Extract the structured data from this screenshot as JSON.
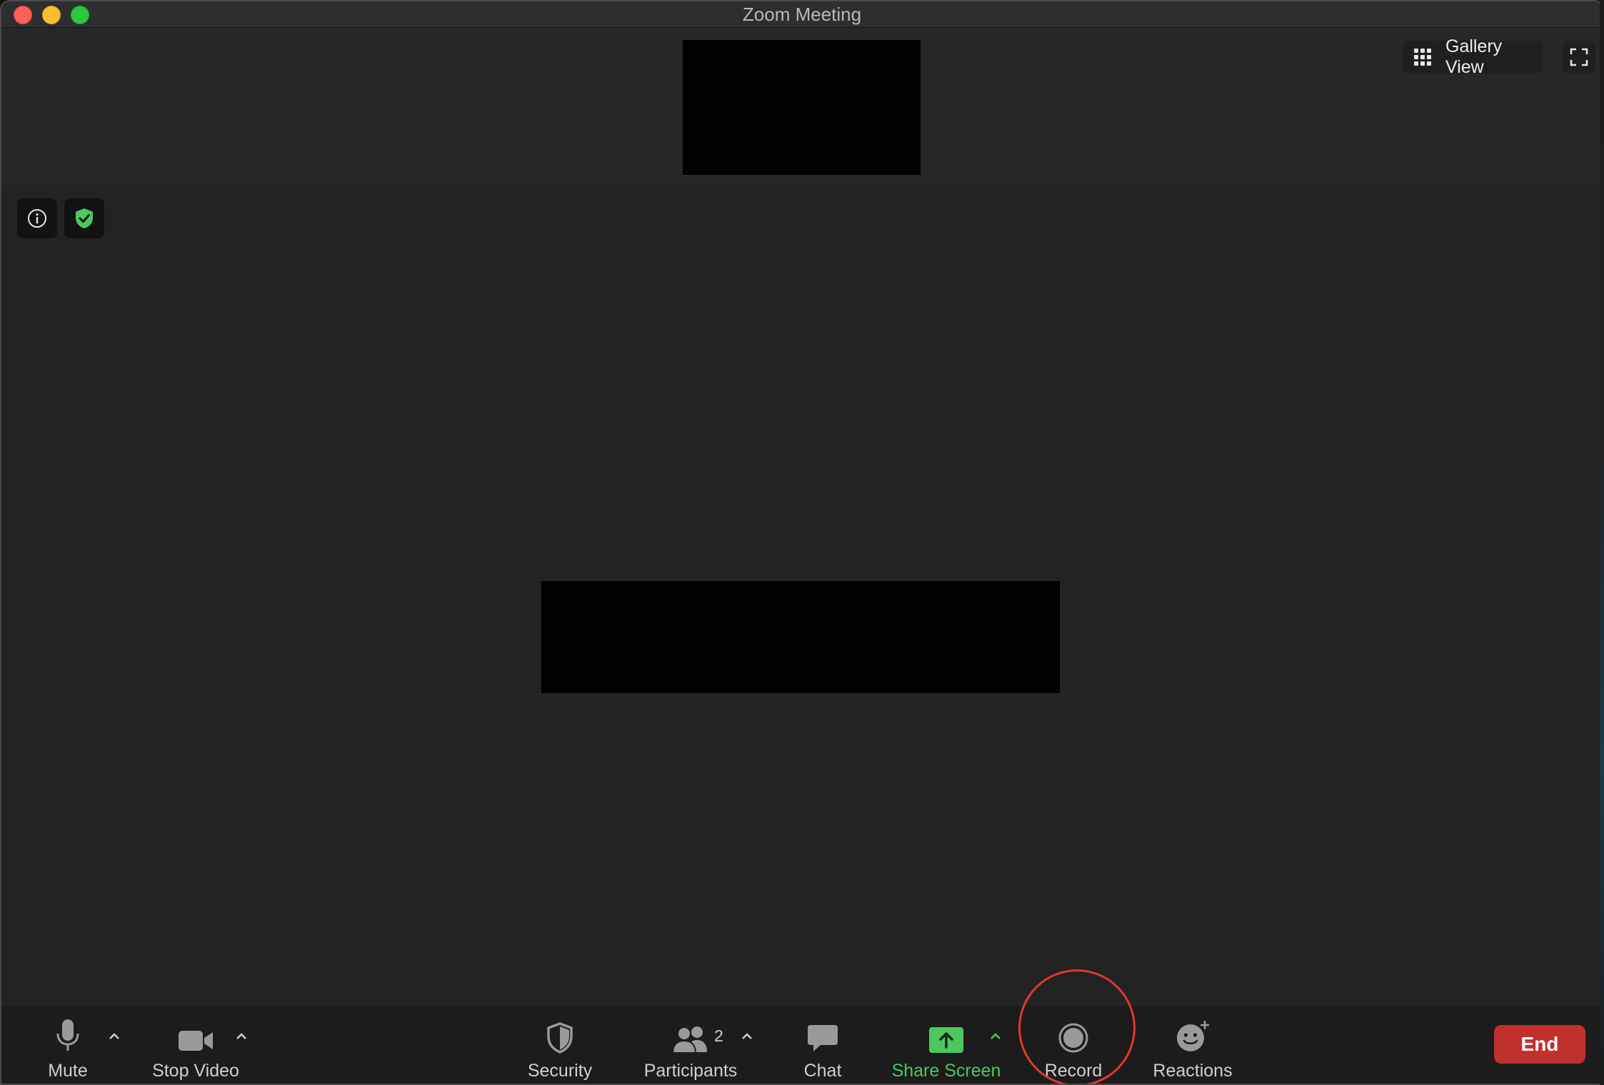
{
  "window": {
    "title": "Zoom Meeting"
  },
  "top_bar": {
    "gallery_view_label": "Gallery View",
    "gallery_icon": "grid-icon",
    "fullscreen_icon": "fullscreen-icon"
  },
  "meeting_info": {
    "info_icon": "info-icon",
    "encryption_icon": "shield-check-icon",
    "encryption_color": "#4cc760"
  },
  "toolbar": {
    "mute": {
      "label": "Mute",
      "icon": "microphone-icon"
    },
    "stop_video": {
      "label": "Stop Video",
      "icon": "video-camera-icon"
    },
    "security": {
      "label": "Security",
      "icon": "shield-icon"
    },
    "participants": {
      "label": "Participants",
      "icon": "participants-icon",
      "count": "2"
    },
    "chat": {
      "label": "Chat",
      "icon": "chat-bubble-icon"
    },
    "share_screen": {
      "label": "Share Screen",
      "icon": "share-arrow-icon",
      "color": "#4cc760"
    },
    "record": {
      "label": "Record",
      "icon": "record-icon"
    },
    "reactions": {
      "label": "Reactions",
      "icon": "smiley-plus-icon"
    },
    "end": {
      "label": "End",
      "color": "#c0312e"
    }
  },
  "annotation": {
    "highlight_color": "#e03a2a"
  }
}
